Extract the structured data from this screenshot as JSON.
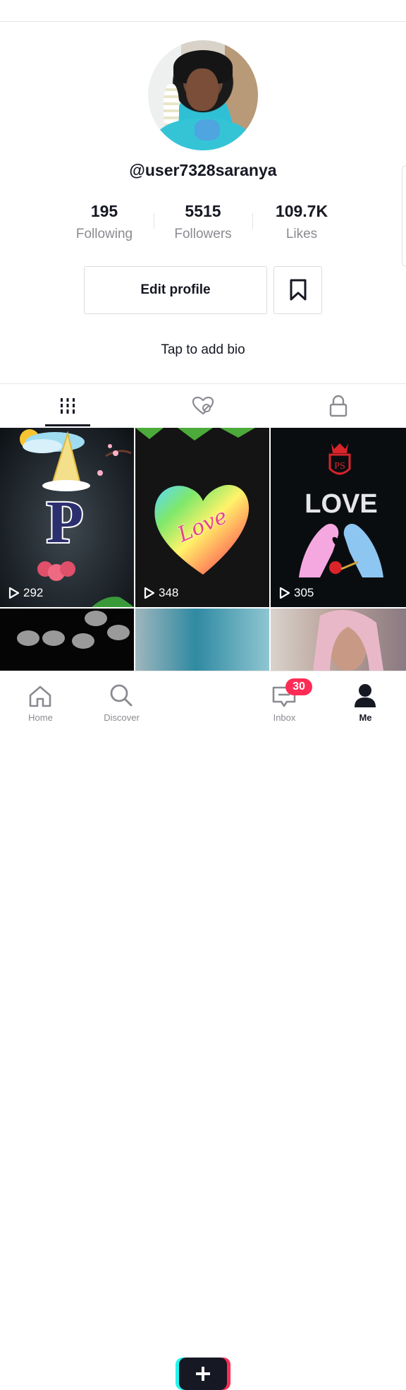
{
  "profile": {
    "username": "@user7328saranya",
    "stats": [
      {
        "value": "195",
        "label": "Following"
      },
      {
        "value": "5515",
        "label": "Followers"
      },
      {
        "value": "109.7K",
        "label": "Likes"
      }
    ],
    "edit_label": "Edit profile",
    "bio_placeholder": "Tap to add bio"
  },
  "videos": [
    {
      "views": "292"
    },
    {
      "views": "348"
    },
    {
      "views": "305"
    }
  ],
  "thumbnail_text": {
    "love_title": "LOVE",
    "heart_text": "Love",
    "letter": "P",
    "crest": "PS"
  },
  "nav": {
    "items": [
      {
        "label": "Home",
        "icon": "home-icon"
      },
      {
        "label": "Discover",
        "icon": "search-icon"
      },
      {
        "label": "",
        "icon": "plus-icon"
      },
      {
        "label": "Inbox",
        "icon": "inbox-icon"
      },
      {
        "label": "Me",
        "icon": "person-icon"
      }
    ],
    "inbox_badge": "30"
  },
  "colors": {
    "accent": "#fe2c55",
    "cyan": "#25f4ee",
    "text": "#161823",
    "muted": "#8a8b91"
  }
}
